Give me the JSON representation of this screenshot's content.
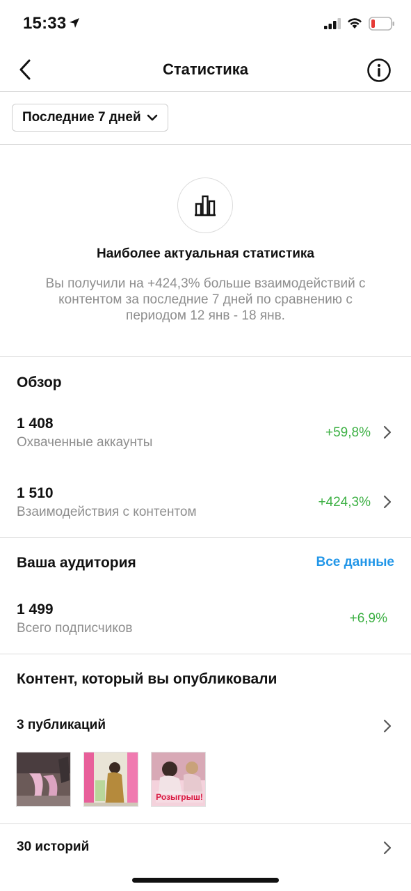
{
  "status_bar": {
    "time": "15:33",
    "icons": [
      "location-arrow-icon",
      "signal-icon",
      "wifi-icon",
      "battery-low-icon"
    ],
    "battery_color": "#e53935"
  },
  "nav": {
    "title": "Статистика",
    "back_icon": "chevron-left-icon",
    "info_icon": "info-icon"
  },
  "filter": {
    "period_label": "Последние 7 дней",
    "icon": "chevron-down-icon"
  },
  "highlight": {
    "icon": "bar-chart-icon",
    "title": "Наиболее актуальная статистика",
    "text": "Вы получили на +424,3% больше взаимодействий с контентом за последние 7 дней по сравнению с периодом 12 янв - 18 янв."
  },
  "overview": {
    "title": "Обзор",
    "metrics": [
      {
        "value": "1 408",
        "label": "Охваченные аккаунты",
        "change": "+59,8%"
      },
      {
        "value": "1 510",
        "label": "Взаимодействия с контентом",
        "change": "+424,3%"
      }
    ]
  },
  "audience": {
    "title": "Ваша аудитория",
    "see_all": "Все данные",
    "metric": {
      "value": "1 499",
      "label": "Всего подписчиков",
      "change": "+6,9%"
    }
  },
  "content": {
    "title": "Контент, который вы опубликовали",
    "posts_label": "3 публикаций",
    "stories_label": "30 историй",
    "thumb3_caption": "Розыгрыш!"
  },
  "colors": {
    "positive": "#3cb043",
    "link": "#2196e8",
    "secondary_text": "#8e8e8e",
    "divider": "#dbdbdb"
  }
}
